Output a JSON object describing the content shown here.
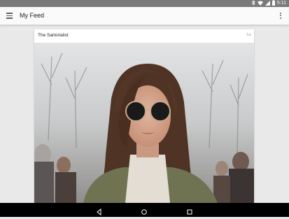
{
  "status": {
    "time": "5:11",
    "icons": [
      "bluetooth-icon",
      "wifi-icon",
      "signal-icon",
      "battery-icon"
    ]
  },
  "app_bar": {
    "title": "My Feed",
    "menu_icon": "menu-icon",
    "overflow_icon": "more-vert-icon"
  },
  "card": {
    "source": "The Sartorialist",
    "age": "1w",
    "image": "portrait-photo"
  },
  "nav": {
    "icons": [
      "back-icon",
      "home-icon",
      "recents-icon"
    ]
  }
}
